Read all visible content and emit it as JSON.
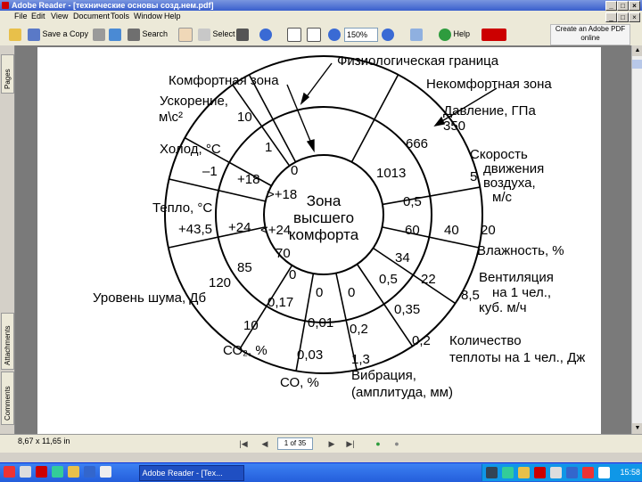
{
  "window": {
    "title": "Adobe Reader - [технические основы созд.нем.pdf]"
  },
  "menu": [
    "File",
    "Edit",
    "View",
    "Document",
    "Tools",
    "Window",
    "Help"
  ],
  "toolbar": {
    "save_label": "Save a Copy",
    "search_label": "Search",
    "select_label": "Select",
    "zoom_value": "150%",
    "help_label": "Help",
    "create_pdf": "Create an Adobe PDF online"
  },
  "side_tabs": [
    "Pages",
    "Attachments",
    "Comments"
  ],
  "status": {
    "page_size": "8,67 x 11,65 in",
    "page_indicator": "1 of 35"
  },
  "taskbar": {
    "app_button": "Adobe Reader - [Tex...",
    "clock": "15:58"
  },
  "diagram": {
    "top_labels": {
      "physio": "Физиологическая граница",
      "comfort": "Комфортная зона",
      "noncomfort": "Некомфортная зона"
    },
    "center": [
      "Зона",
      "высшего",
      "комфорта"
    ],
    "params": {
      "accel": [
        "Ускорение,",
        "м\\с²"
      ],
      "cold": "Холод, °С",
      "heat": "Тепло, °С",
      "noise": "Уровень шума, Дб",
      "co2": "СО₂, %",
      "co": "СО, %",
      "vibration": [
        "Вибрация,",
        "(амплитуда, мм)"
      ],
      "heat_amount": [
        "Количество",
        "теплоты на 1 чел., Дж"
      ],
      "ventilation": [
        "Вентиляция",
        "на 1 чел.,",
        "куб. м/ч"
      ],
      "humidity": "Влажность, %",
      "air_speed": [
        "Скорость",
        "движения",
        "воздуха,",
        "м/с"
      ],
      "pressure": [
        "Давление, ГПа",
        "350"
      ]
    },
    "values": {
      "v10a": "10",
      "v1": "1",
      "v0a": "0",
      "vm1": "–1",
      "v18": "+18",
      "v18c": ">+18",
      "v435": "+43,5",
      "v24": "+24",
      "v24c": "<+24",
      "v70": "70",
      "v85": "85",
      "v120": "120",
      "v0b": "0",
      "v017": "0,17",
      "v10b": "10",
      "v0c": "0",
      "v0d": "0",
      "v001": "0,01",
      "v003": "0,03",
      "v02a": "0,2",
      "v13": "1,3",
      "v05a": "0,5",
      "v035": "0,35",
      "v02b": "0,2",
      "v22": "22",
      "v85b": "8,5",
      "v34": "34",
      "v60": "60",
      "v40": "40",
      "v20": "20",
      "v05b": "0,5",
      "v5": "5",
      "v1013": "1013",
      "v666": "666"
    }
  }
}
